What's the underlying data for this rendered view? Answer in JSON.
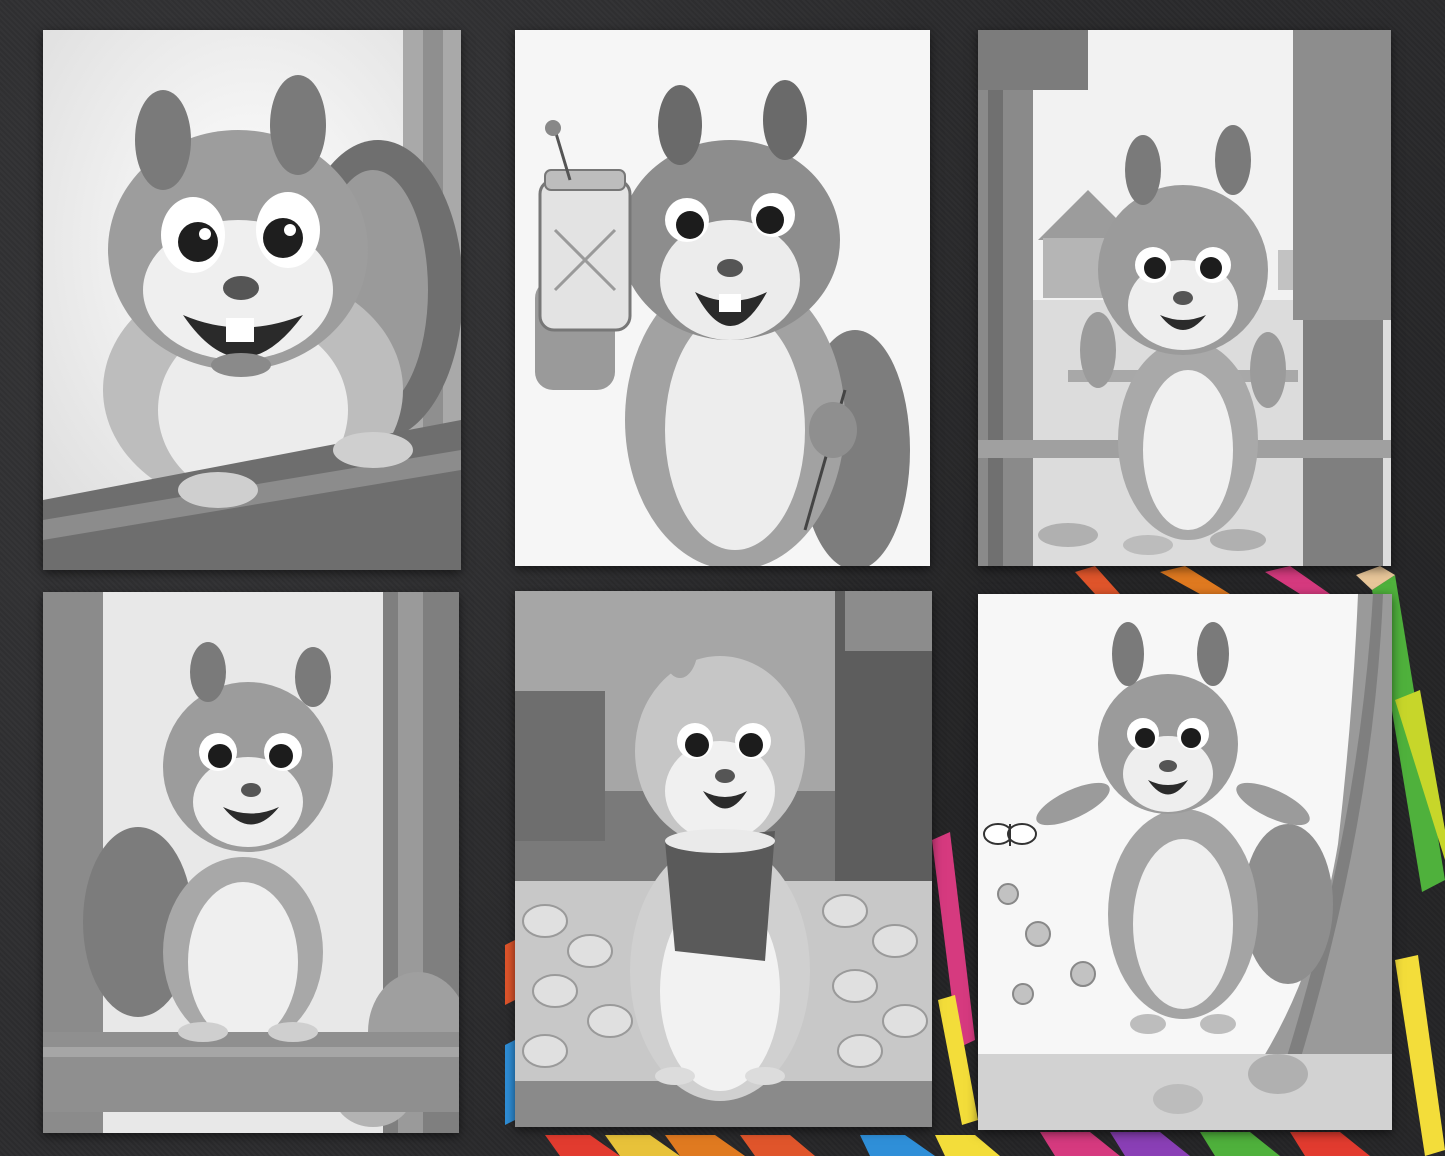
{
  "scene": {
    "background_color": "#2c2c2e",
    "style": "grayscale pencil coloring pages laid on dark felt with colored pencils"
  },
  "cards": [
    {
      "id": "card-1",
      "subject": "chipmunk-peeking-over-log-icon",
      "background": "forest"
    },
    {
      "id": "card-2",
      "subject": "chipmunk-holding-drink-jar-icon",
      "background": "plain"
    },
    {
      "id": "card-3",
      "subject": "chipmunk-at-farm-gate-icon",
      "background": "farmyard"
    },
    {
      "id": "card-4",
      "subject": "chipmunk-sitting-on-log-icon",
      "background": "forest"
    },
    {
      "id": "card-5",
      "subject": "chipmunk-holding-nut-box-icon",
      "background": "market-street"
    },
    {
      "id": "card-6",
      "subject": "chipmunk-jumping-with-butterfly-icon",
      "background": "meadow-tree"
    }
  ],
  "pencil_colors": [
    "#e8c23a",
    "#e0552b",
    "#2f8fd8",
    "#d63a7f",
    "#8a3fb6",
    "#e07a20",
    "#f3dd3a",
    "#4fb13c",
    "#c7d62a",
    "#e23b2f"
  ]
}
